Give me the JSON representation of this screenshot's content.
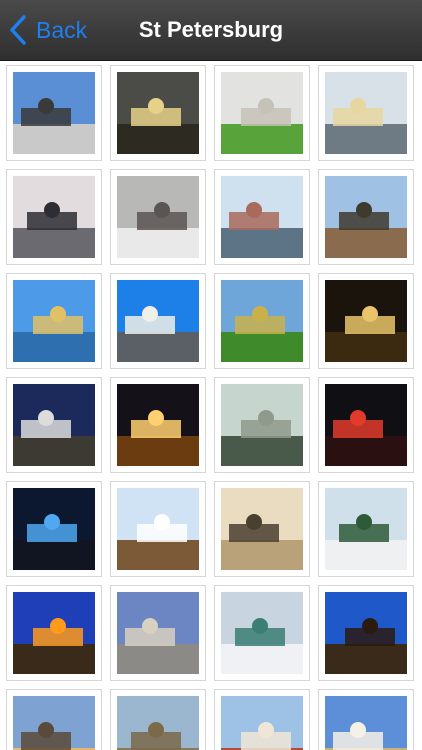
{
  "navbar": {
    "back_label": "Back",
    "title": "St Petersburg",
    "back_color": "#1e7ff0"
  },
  "gallery": {
    "thumbnails": [
      {
        "icon": "bronze-horseman-photo",
        "sky": "#5a8fd6",
        "ground": "#c9c9c9",
        "accent": "#3a3a3a"
      },
      {
        "icon": "palace-storm-photo",
        "sky": "#4b4b47",
        "ground": "#2d2a22",
        "accent": "#e6d188"
      },
      {
        "icon": "fortress-lawn-photo",
        "sky": "#e2e2e0",
        "ground": "#58a33a",
        "accent": "#c7c2b8"
      },
      {
        "icon": "bridge-canal-photo",
        "sky": "#d8e0e8",
        "ground": "#6f7b84",
        "accent": "#e8d6a0"
      },
      {
        "icon": "neva-embankment-photo",
        "sky": "#e3dcdf",
        "ground": "#6b6a70",
        "accent": "#2d2d35"
      },
      {
        "icon": "statue-winter-photo",
        "sky": "#b8b8b6",
        "ground": "#e9e9e9",
        "accent": "#5a5552"
      },
      {
        "icon": "canal-boats-photo",
        "sky": "#cfe0ef",
        "ground": "#5d7486",
        "accent": "#a86a5a"
      },
      {
        "icon": "monument-statue-photo",
        "sky": "#9fc1e3",
        "ground": "#8a6b4e",
        "accent": "#3e3a2e"
      },
      {
        "icon": "cathedral-waterfront-photo",
        "sky": "#4d9be8",
        "ground": "#2e6fb0",
        "accent": "#e0c166"
      },
      {
        "icon": "alexander-column-photo",
        "sky": "#1d7fe8",
        "ground": "#5b5f66",
        "accent": "#f0efe8"
      },
      {
        "icon": "st-isaac-cathedral-photo",
        "sky": "#6fa6d9",
        "ground": "#3f8b2c",
        "accent": "#c9b04b"
      },
      {
        "icon": "admiralty-night-photo",
        "sky": "#1a140c",
        "ground": "#3b2a10",
        "accent": "#e9c46a"
      },
      {
        "icon": "horseman-night-photo",
        "sky": "#1b2a5a",
        "ground": "#3c3a33",
        "accent": "#dcdcdc"
      },
      {
        "icon": "bridge-night-lights-photo",
        "sky": "#141218",
        "ground": "#6a3c10",
        "accent": "#ffd070"
      },
      {
        "icon": "garden-sculpture-photo",
        "sky": "#c6d6cf",
        "ground": "#4a5a4a",
        "accent": "#8f9a8c"
      },
      {
        "icon": "night-traffic-monument-photo",
        "sky": "#0f0f14",
        "ground": "#2a1010",
        "accent": "#e23b2a"
      },
      {
        "icon": "palace-blue-lights-photo",
        "sky": "#0c1830",
        "ground": "#111522",
        "accent": "#4fa8f0"
      },
      {
        "icon": "tall-ships-photo",
        "sky": "#cfe3f4",
        "ground": "#7c5a38",
        "accent": "#ffffff"
      },
      {
        "icon": "archway-street-photo",
        "sky": "#e9dcc0",
        "ground": "#b9a27a",
        "accent": "#4a4030"
      },
      {
        "icon": "christmas-tree-photo",
        "sky": "#cfe0ea",
        "ground": "#eef0f2",
        "accent": "#2f5a3a"
      },
      {
        "icon": "street-lamp-dusk-photo",
        "sky": "#1f3fb8",
        "ground": "#3a2a1a",
        "accent": "#ff9a1a"
      },
      {
        "icon": "general-staff-arch-photo",
        "sky": "#6c86c4",
        "ground": "#8b8a86",
        "accent": "#d8d0c0"
      },
      {
        "icon": "hermitage-snow-photo",
        "sky": "#c8d4e0",
        "ground": "#eff1f4",
        "accent": "#3b7e72"
      },
      {
        "icon": "horse-tamer-statue-photo",
        "sky": "#1f58c8",
        "ground": "#3a2a1a",
        "accent": "#2a1a10"
      },
      {
        "icon": "embankment-sunset-photo",
        "sky": "#7ea3d2",
        "ground": "#e9b86f",
        "accent": "#5a4a3a"
      },
      {
        "icon": "cathedral-dome-photo",
        "sky": "#9bb6cf",
        "ground": "#8a7a5a",
        "accent": "#7a6a4a"
      },
      {
        "icon": "red-tower-street-photo",
        "sky": "#9ec2e6",
        "ground": "#b74a3a",
        "accent": "#f0e6d6"
      },
      {
        "icon": "spire-sunset-photo",
        "sky": "#5c8fd8",
        "ground": "#c9b27a",
        "accent": "#f6f1e6"
      }
    ]
  }
}
